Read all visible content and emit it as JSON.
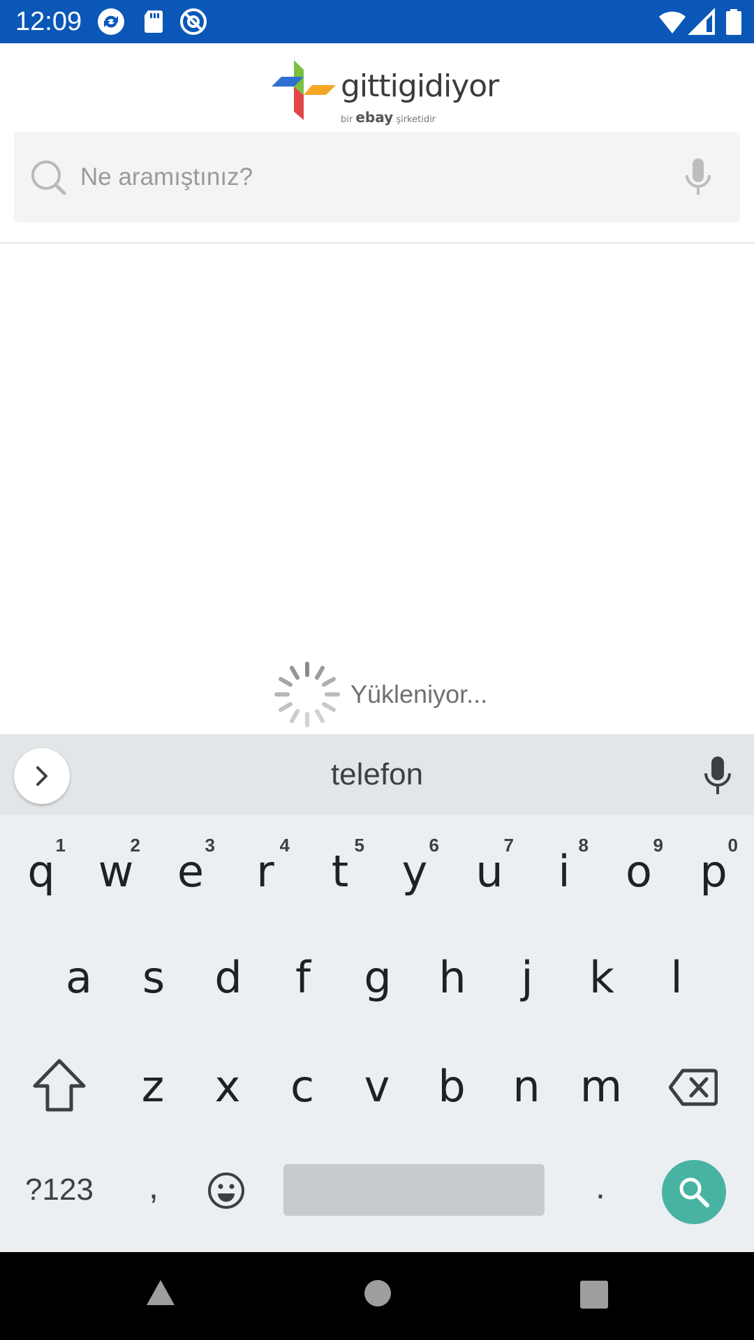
{
  "status_bar": {
    "time": "12:09",
    "left_icons": [
      "sync-icon",
      "sd-card-icon",
      "at-sign-icon"
    ],
    "right_icons": [
      "wifi-icon",
      "signal-icon",
      "battery-icon"
    ]
  },
  "header": {
    "logo_text": "gittigidiyor",
    "logo_sub_pre": "bir",
    "logo_sub_brand": "ebay",
    "logo_sub_post": "şirketidir"
  },
  "search": {
    "placeholder": "Ne aramıştınız?"
  },
  "loading": {
    "text": "Yükleniyor..."
  },
  "keyboard": {
    "suggestion": "telefon",
    "row1": [
      {
        "key": "q",
        "hint": "1"
      },
      {
        "key": "w",
        "hint": "2"
      },
      {
        "key": "e",
        "hint": "3"
      },
      {
        "key": "r",
        "hint": "4"
      },
      {
        "key": "t",
        "hint": "5"
      },
      {
        "key": "y",
        "hint": "6"
      },
      {
        "key": "u",
        "hint": "7"
      },
      {
        "key": "i",
        "hint": "8"
      },
      {
        "key": "o",
        "hint": "9"
      },
      {
        "key": "p",
        "hint": "0"
      }
    ],
    "row2": [
      "a",
      "s",
      "d",
      "f",
      "g",
      "h",
      "j",
      "k",
      "l"
    ],
    "row3": [
      "z",
      "x",
      "c",
      "v",
      "b",
      "n",
      "m"
    ],
    "symbols_label": "?123",
    "comma": ",",
    "period": ".",
    "colors": {
      "background": "#eceff1",
      "action_key": "#48b3a2",
      "status_bar": "#0a57b8"
    }
  }
}
